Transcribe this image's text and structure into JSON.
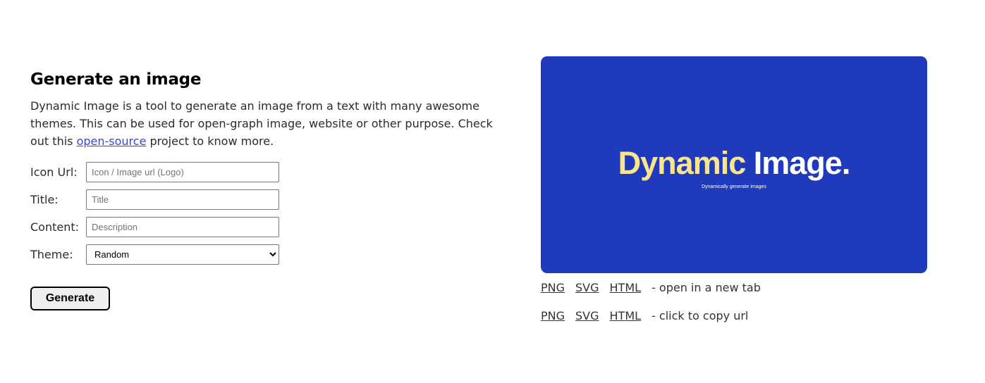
{
  "heading": "Generate an image",
  "description": {
    "before": "Dynamic Image is a tool to generate an image from a text with many awesome themes. This can be used for open-graph image, website or other purpose. Check out this ",
    "link": "open-source",
    "after": " project to know more."
  },
  "form": {
    "icon_label": "Icon Url:",
    "icon_placeholder": "Icon / Image url (Logo)",
    "title_label": "Title:",
    "title_placeholder": "Title",
    "content_label": "Content:",
    "content_placeholder": "Description",
    "theme_label": "Theme:",
    "theme_value": "Random",
    "generate_label": "Generate"
  },
  "preview": {
    "title_part1": "Dynamic",
    "title_part2": "Image.",
    "subtitle": "Dynamically generate images",
    "background": "#1f3bbb",
    "accent": "#fbe58a"
  },
  "links": {
    "open": {
      "png": "PNG",
      "svg": "SVG",
      "html": "HTML",
      "hint": "- open in a new tab"
    },
    "copy": {
      "png": "PNG",
      "svg": "SVG",
      "html": "HTML",
      "hint": "- click to copy url"
    }
  }
}
